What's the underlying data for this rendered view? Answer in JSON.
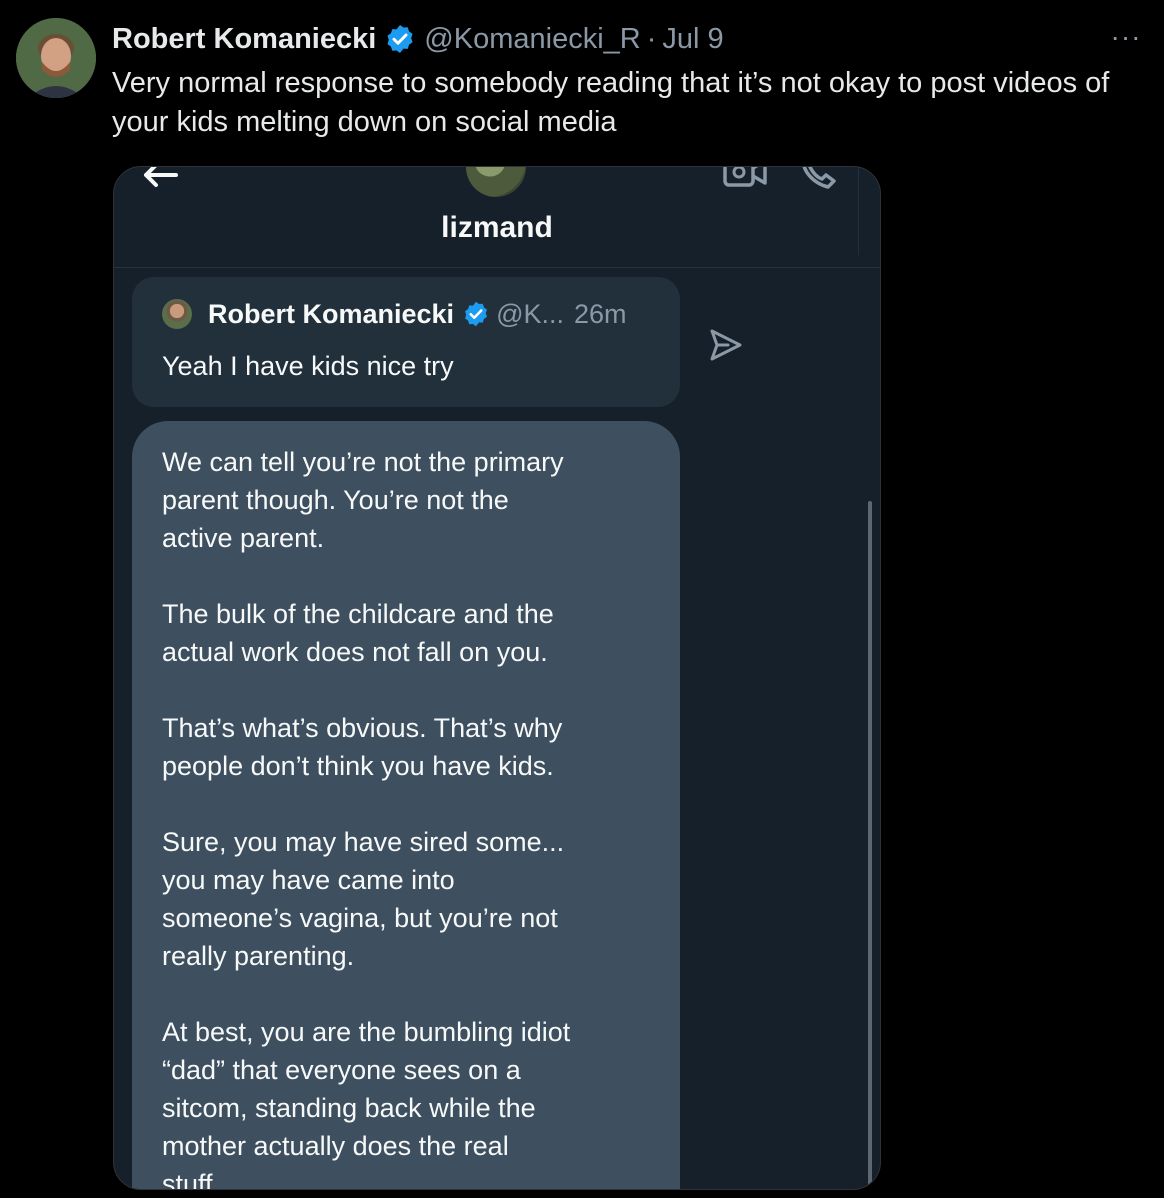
{
  "post": {
    "author_name": "Robert Komaniecki",
    "handle": "@Komaniecki_R",
    "separator": "·",
    "date": "Jul 9",
    "more_label": "···",
    "text": "Very normal response to somebody reading that it’s not okay to post videos of your kids melting down on social media"
  },
  "screenshot": {
    "contact_name": "lizmand",
    "quoted": {
      "name": "Robert Komaniecki",
      "handle": "@K...",
      "time": "26m",
      "text": "Yeah I have kids nice try"
    },
    "message_paragraphs": [
      "We can tell you’re not the primary\nparent though. You’re not the\nactive parent.",
      "The bulk of the childcare and the\nactual work does not fall on you.",
      "That’s what’s obvious. That’s why\npeople don’t think you have kids.",
      "Sure, you may have sired some...\nyou may have came into\nsomeone’s vagina, but you’re not\nreally parenting.",
      "At best, you are the bumbling idiot\n“dad” that everyone sees on a\nsitcom, standing back while the\nmother actually does the real\nstuff"
    ]
  },
  "icons": {
    "verified": "verified-badge-icon",
    "more": "more-options-icon",
    "back": "back-arrow-icon",
    "video": "video-call-icon",
    "phone": "phone-call-icon",
    "send": "send-icon"
  },
  "colors": {
    "background": "#000000",
    "verified_blue": "#1d9bf0",
    "secondary_text": "#8b98a5",
    "dm_background": "#15202b",
    "bubble": "#3e4f5f",
    "quoted_card": "#22303c"
  }
}
